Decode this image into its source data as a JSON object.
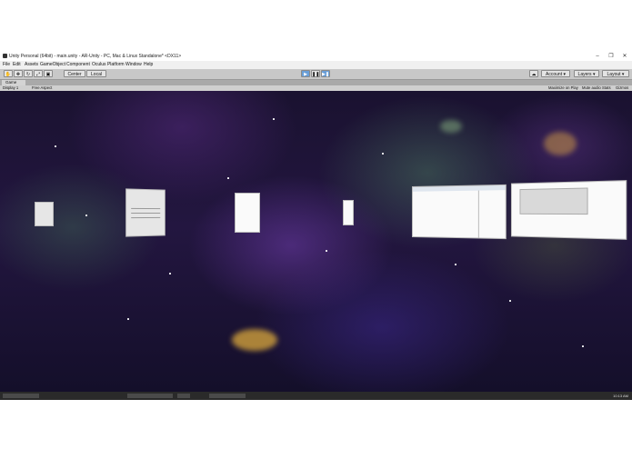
{
  "window": {
    "title": "Unity Personal (64bit) - main.unity - AR-Unity - PC, Mac & Linux Standalone* <DX11>",
    "controls": {
      "minimize": "–",
      "maximize": "❐",
      "close": "✕"
    }
  },
  "menu": [
    "File",
    "Edit",
    "Assets",
    "GameObject",
    "Component",
    "Oculus Platform",
    "Window",
    "Help"
  ],
  "toolbar": {
    "pivot_label": "Center",
    "space_label": "Local",
    "play_glyph": "▶",
    "pause_glyph": "❚❚",
    "step_glyph": "▶❚",
    "collab_glyph": "☁",
    "account_label": "Account ▾",
    "layers_label": "Layers ▾",
    "layout_label": "Layout ▾"
  },
  "game_view": {
    "tab_label": "Game",
    "display_label": "Display 1",
    "aspect_label": "Free Aspect",
    "maximize_label": "Maximize on Play",
    "mute_label": "Mute audio",
    "stats_label": "Stats",
    "gizmos_label": "Gizmos"
  },
  "icons": [
    "unity-icon",
    "hand-tool-icon",
    "move-tool-icon",
    "rotate-tool-icon",
    "scale-tool-icon",
    "rect-tool-icon",
    "play-icon",
    "pause-icon",
    "step-icon",
    "cloud-icon"
  ],
  "colors": {
    "play_accent": "#6a9fd8",
    "space_bg": "#1a1230",
    "editor_gray": "#c2c2c2"
  },
  "taskbar": {
    "clock": "10:13 AM"
  }
}
